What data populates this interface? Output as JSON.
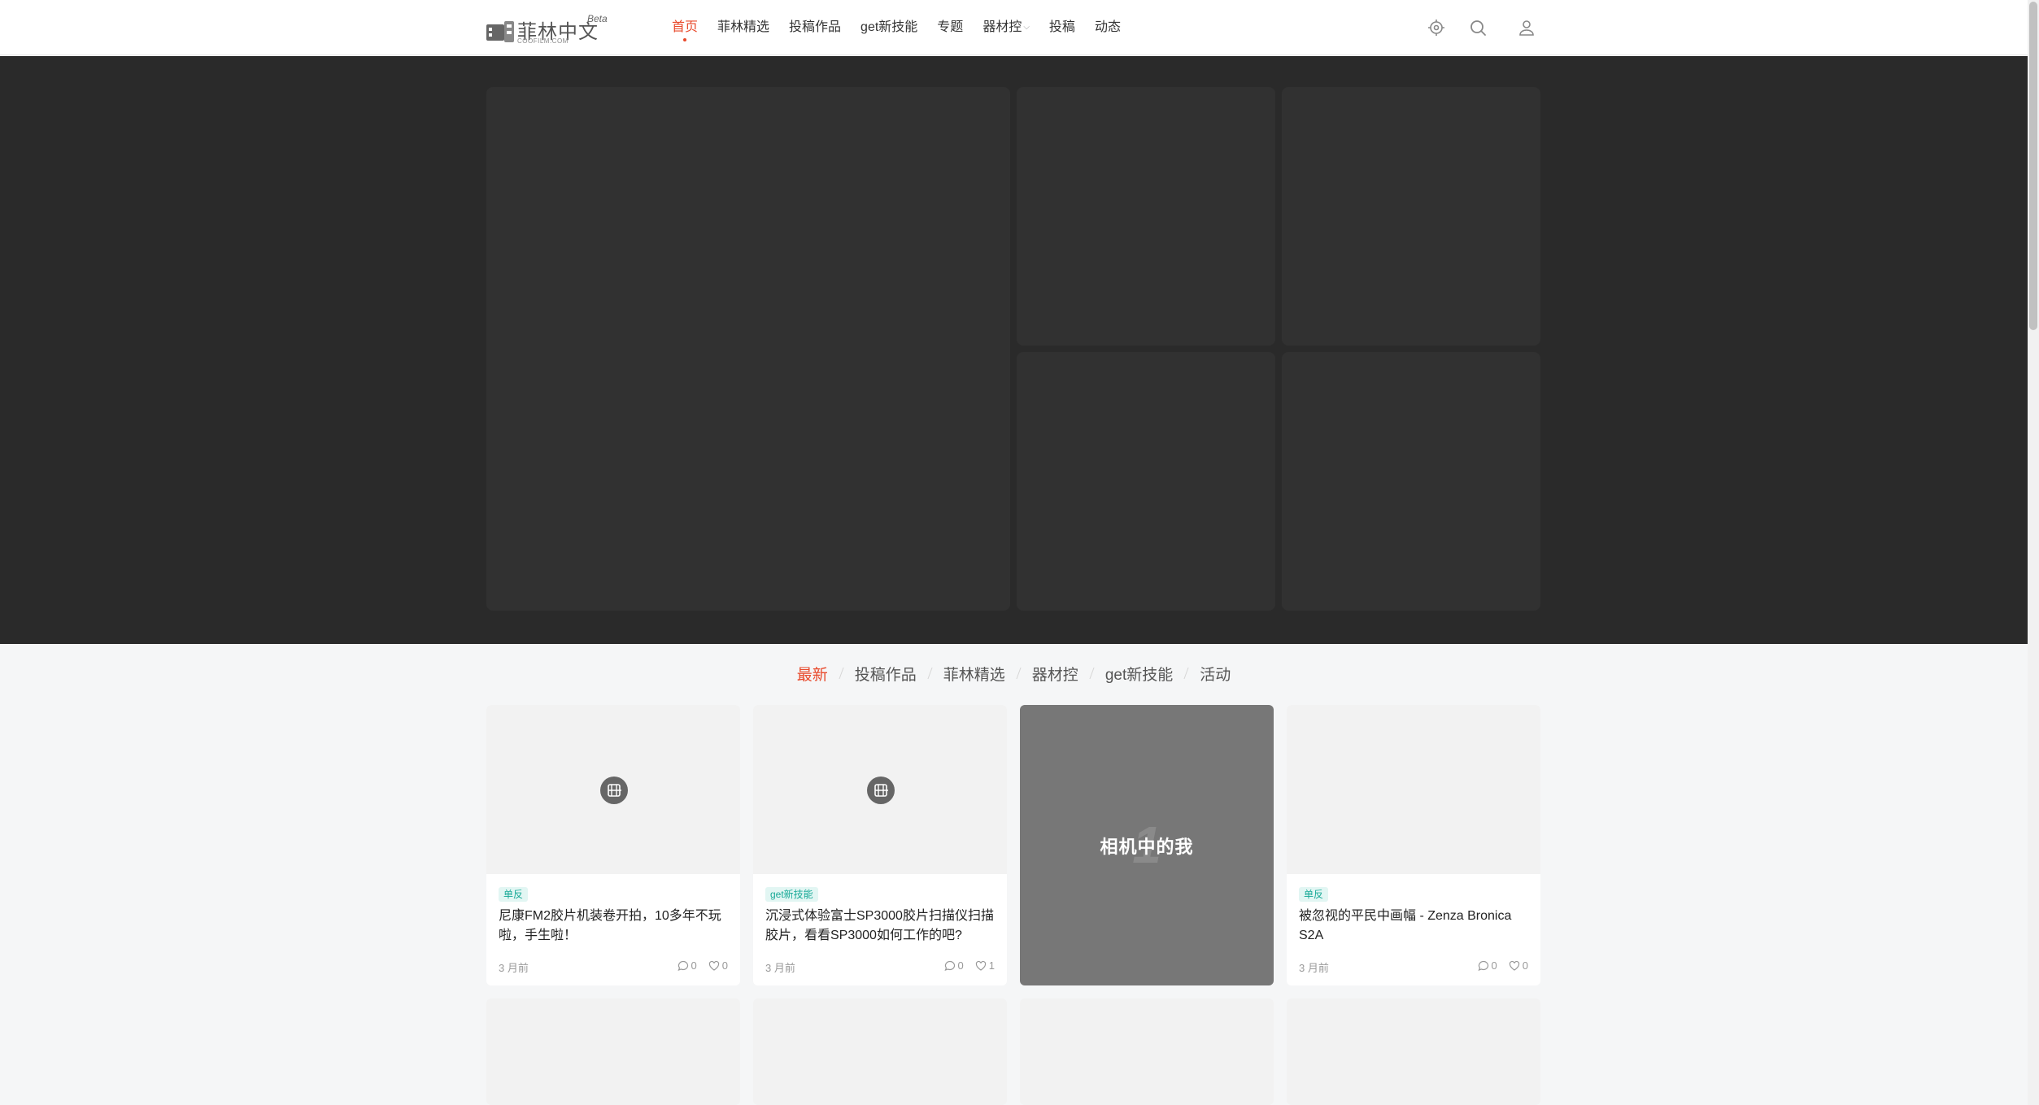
{
  "logo": {
    "name": "菲林中文",
    "sub": "COOFILM.COM",
    "beta": "Beta"
  },
  "nav": [
    {
      "label": "首页",
      "active": true
    },
    {
      "label": "菲林精选"
    },
    {
      "label": "投稿作品"
    },
    {
      "label": "get新技能"
    },
    {
      "label": "专题"
    },
    {
      "label": "器材控",
      "dropdown": true,
      "caret": "⌵"
    },
    {
      "label": "投稿"
    },
    {
      "label": "动态"
    }
  ],
  "header_tools": [
    "theme-icon",
    "search-icon",
    "user-icon"
  ],
  "tabs": [
    {
      "label": "最新",
      "active": true
    },
    {
      "label": "投稿作品"
    },
    {
      "label": "菲林精选"
    },
    {
      "label": "器材控"
    },
    {
      "label": "get新技能"
    },
    {
      "label": "活动"
    }
  ],
  "cards": [
    {
      "tag": "单反",
      "title": "尼康FM2胶片机装卷开拍，10多年不玩啦，手生啦！",
      "time": "3 月前",
      "comments": "0",
      "likes": "0"
    },
    {
      "tag": "get新技能",
      "title": "沉浸式体验富士SP3000胶片扫描仪扫描胶片，看看SP3000如何工作的吧?",
      "time": "3 月前",
      "comments": "0",
      "likes": "1"
    },
    {
      "topic_title": "相机中的我",
      "topic_number": "1"
    },
    {
      "tag": "单反",
      "title": "被忽视的平民中画幅 - Zenza Bronica S2A",
      "time": "3 月前",
      "comments": "0",
      "likes": "0"
    }
  ],
  "colors": {
    "accent": "#e8492b",
    "tag": "#1aaa98",
    "hero_bg": "#2a2a2a"
  }
}
